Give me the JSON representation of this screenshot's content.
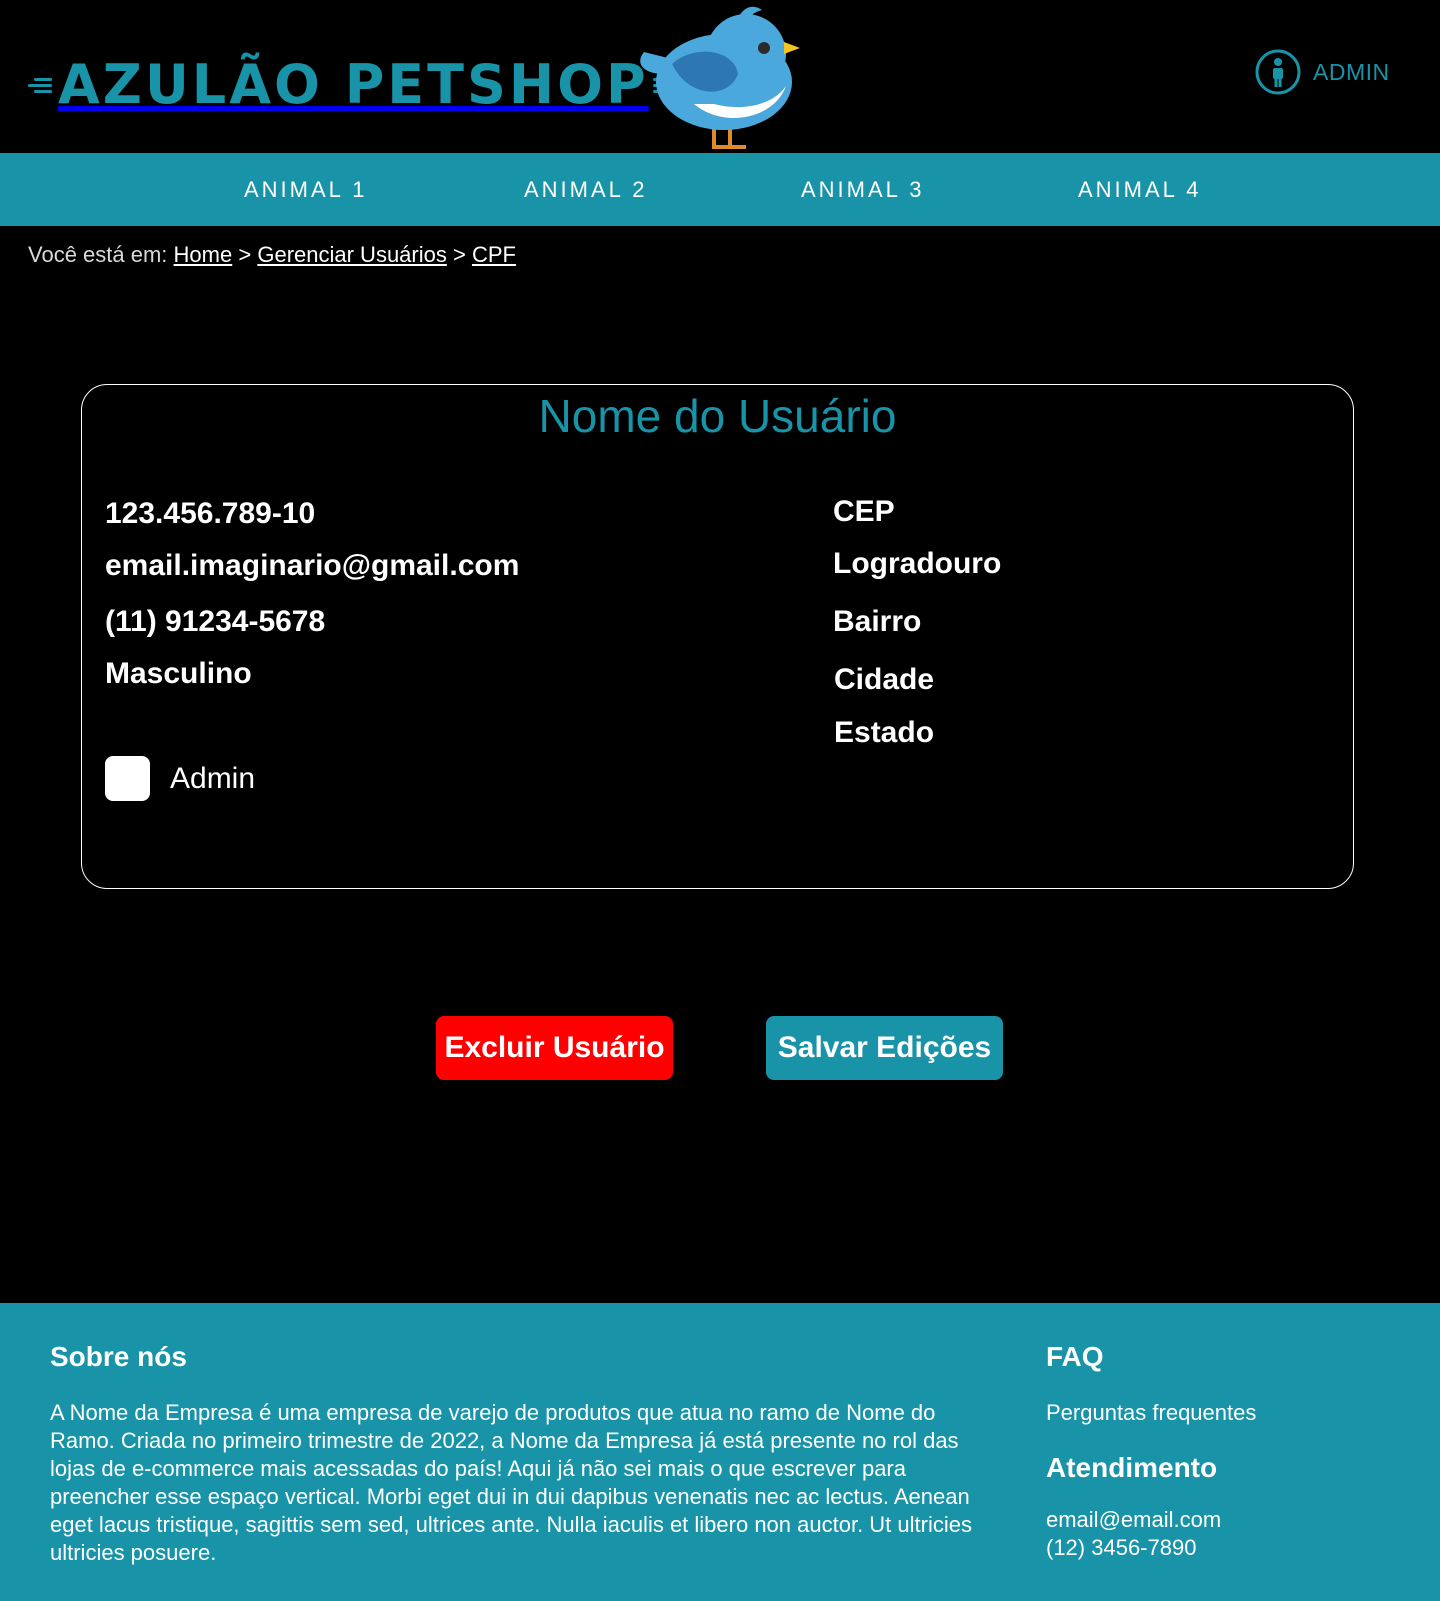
{
  "header": {
    "brand": "AZULÃO PETSHOP",
    "admin_label": "ADMIN"
  },
  "nav": {
    "items": [
      {
        "label": "ANIMAL 1"
      },
      {
        "label": "ANIMAL 2"
      },
      {
        "label": "ANIMAL 3"
      },
      {
        "label": "ANIMAL 4"
      }
    ]
  },
  "breadcrumb": {
    "prefix": "Você está em:",
    "separator": ">",
    "items": [
      {
        "label": "Home"
      },
      {
        "label": "Gerenciar Usuários"
      },
      {
        "label": "CPF"
      }
    ]
  },
  "user": {
    "name": "Nome do Usuário",
    "cpf": "123.456.789-10",
    "email": "email.imaginario@gmail.com",
    "phone": "(11) 91234-5678",
    "gender": "Masculino",
    "admin_label": "Admin",
    "admin_checked": false,
    "cep": "CEP",
    "logradouro": "Logradouro",
    "bairro": "Bairro",
    "cidade": "Cidade",
    "estado": "Estado"
  },
  "actions": {
    "delete_label": "Excluir Usuário",
    "save_label": "Salvar Edições"
  },
  "footer": {
    "about_title": "Sobre nós",
    "about_text": "A Nome da Empresa é uma empresa de varejo de produtos que atua no ramo de Nome do Ramo. Criada no primeiro trimestre de 2022, a Nome da Empresa já está presente no rol das  lojas de e-commerce mais acessadas do país! Aqui já não sei mais o que escrever para preencher esse espaço vertical. Morbi eget dui in dui dapibus venenatis nec ac lectus. Aenean eget lacus tristique, sagittis sem sed, ultrices ante. Nulla iaculis et libero non auctor. Ut ultricies ultricies posuere.",
    "faq_title": "FAQ",
    "faq_link": "Perguntas frequentes",
    "support_title": "Atendimento",
    "support_email": "email@email.com",
    "support_phone": "(12) 3456-7890"
  },
  "colors": {
    "accent": "#1893a7",
    "danger": "#ff0000",
    "background": "#000000"
  },
  "icons": {
    "admin": "person-circle-icon",
    "logo": "bluebird-icon"
  }
}
